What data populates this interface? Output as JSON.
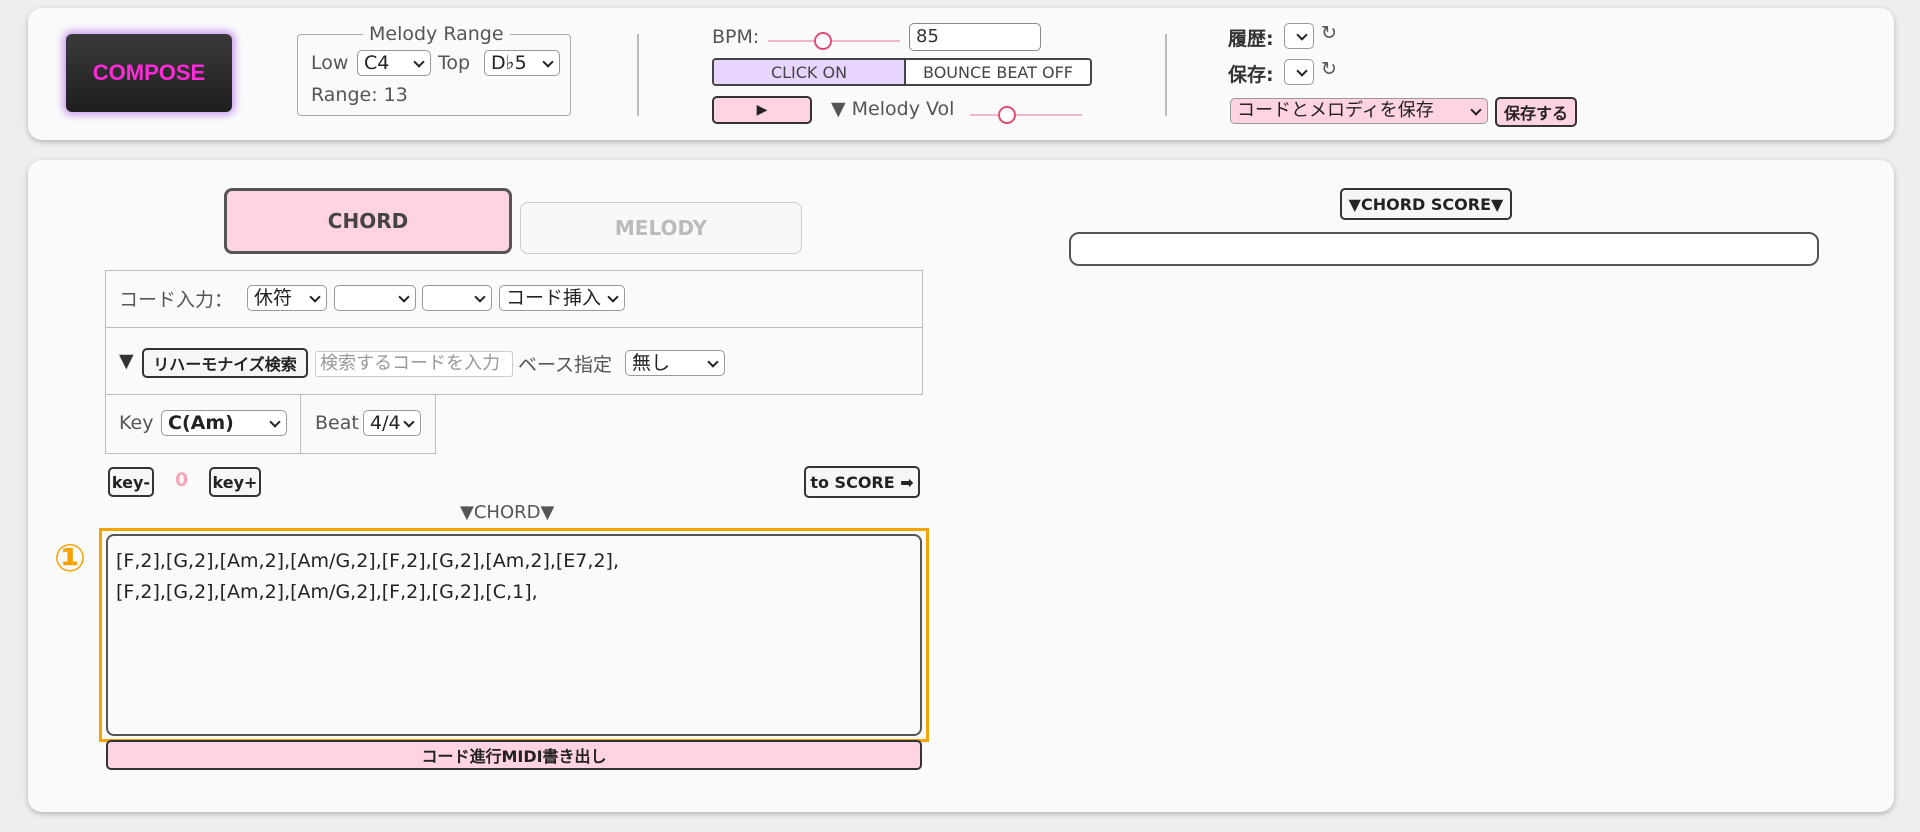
{
  "header": {
    "compose_label": "COMPOSE",
    "melody_range": {
      "legend": "Melody Range",
      "low_label": "Low",
      "low_value": "C4",
      "top_label": "Top",
      "top_value": "D♭5",
      "range_text": "Range: 13"
    },
    "tempo": {
      "bpm_label": "BPM:",
      "bpm_value": "85",
      "click_on": "CLICK ON",
      "bounce_beat_off": "BOUNCE BEAT OFF",
      "play_glyph": "▶",
      "melody_vol_label": "▼ Melody Vol"
    },
    "history": {
      "history_label": "履歴:",
      "save_label": "保存:",
      "refresh_glyph": "↻",
      "save_option": "コードとメロディを保存",
      "save_button": "保存する"
    }
  },
  "main": {
    "tabs": {
      "chord": "CHORD",
      "melody": "MELODY"
    },
    "chord_input": {
      "label": "コード入力：",
      "rest_value": "休符",
      "insert_value": "コード挿入"
    },
    "reharmonize": {
      "toggle": "▼",
      "button": "リハーモナイズ検索",
      "search_placeholder": "検索するコードを入力",
      "bass_label": "ベース指定",
      "bass_value": "無し"
    },
    "key_beat": {
      "key_label": "Key",
      "key_value": "C(Am)",
      "beat_label": "Beat",
      "beat_value": "4/4"
    },
    "transpose": {
      "minus": "key-",
      "value": "0",
      "plus": "key+",
      "to_score": "to SCORE ➡"
    },
    "chord_heading": "▼CHORD▼",
    "chord_text_line1": "[F,2],[G,2],[Am,2],[Am/G,2],[F,2],[G,2],[Am,2],[E7,2],",
    "chord_text_line2": "[F,2],[G,2],[Am,2],[Am/G,2],[F,2],[G,2],[C,1],",
    "annotation_marker": "①",
    "midi_export": "コード進行MIDI書き出し",
    "chord_score_button": "▼CHORD SCORE▼"
  }
}
